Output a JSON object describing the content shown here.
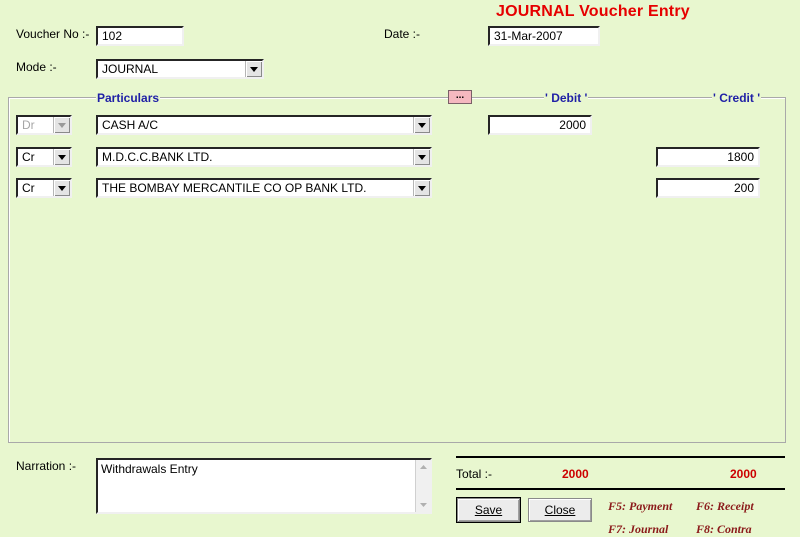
{
  "form": {
    "title": "JOURNAL Voucher Entry",
    "voucher_no_label": "Voucher No :-",
    "voucher_no": "102",
    "date_label": "Date :-",
    "date": "31-Mar-2007",
    "mode_label": "Mode :-",
    "mode": "JOURNAL"
  },
  "grid": {
    "particulars_header": "Particulars",
    "ellipsis_button": "...",
    "debit_header": "' Debit '",
    "credit_header": "' Credit '",
    "rows": [
      {
        "type": "Dr",
        "type_enabled": false,
        "account": "CASH A/C",
        "debit": "2000",
        "credit": ""
      },
      {
        "type": "Cr",
        "type_enabled": true,
        "account": "M.D.C.C.BANK LTD.",
        "debit": "",
        "credit": "1800"
      },
      {
        "type": "Cr",
        "type_enabled": true,
        "account": "THE BOMBAY MERCANTILE CO OP BANK LTD.",
        "debit": "",
        "credit": "200"
      }
    ]
  },
  "narration": {
    "label": "Narration :-",
    "text": "Withdrawals Entry"
  },
  "totals": {
    "label": "Total :-",
    "debit": "2000",
    "credit": "2000"
  },
  "buttons": {
    "save": "Save",
    "close": "Close"
  },
  "shortcuts": {
    "f5": "F5: Payment",
    "f6": "F6: Receipt",
    "f7": "F7: Journal",
    "f8": "F8: Contra"
  },
  "colors": {
    "background": "#e8f7cf",
    "title": "#e60000",
    "header": "#1f1fa6",
    "total": "#cc0000",
    "shortcut": "#8b1a1a"
  }
}
